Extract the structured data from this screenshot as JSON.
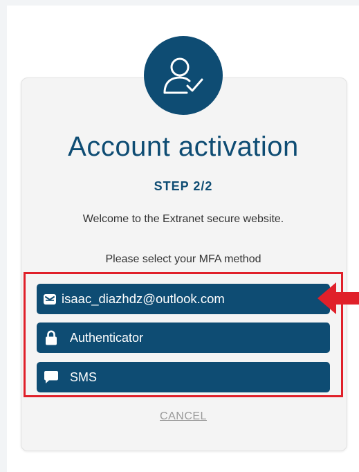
{
  "activation": {
    "title": "Account activation",
    "step": "STEP 2/2",
    "welcome": "Welcome to the Extranet secure website.",
    "prompt": "Please select your MFA method",
    "cancel": "CANCEL"
  },
  "methods": [
    {
      "label": "isaac_diazhdz@outlook.com",
      "icon": "envelope-icon"
    },
    {
      "label": "Authenticator",
      "icon": "lock-icon"
    },
    {
      "label": "SMS",
      "icon": "chat-bubble-icon"
    }
  ],
  "colors": {
    "primary": "#0e4c73",
    "annotation": "#e0202a",
    "cancel": "#9a9a9a"
  }
}
